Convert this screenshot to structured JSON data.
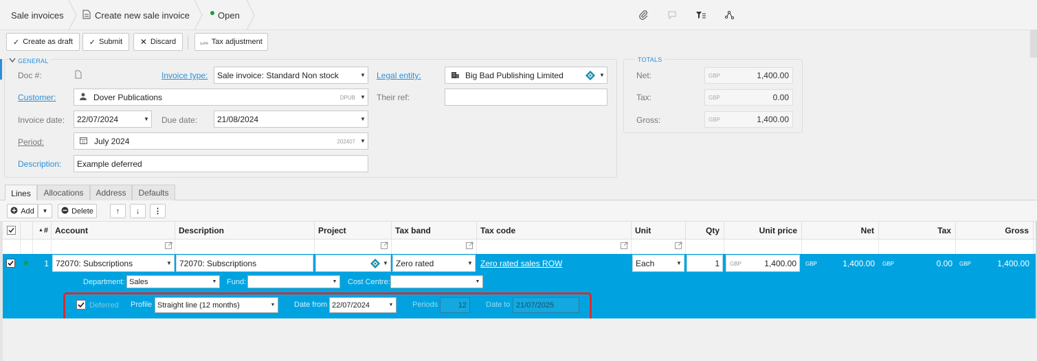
{
  "breadcrumb": {
    "items": [
      "Sale invoices",
      "Create new sale invoice",
      "Open"
    ]
  },
  "toolbar": {
    "create_draft": "Create as draft",
    "submit": "Submit",
    "discard": "Discard",
    "tax_adjustment": "Tax adjustment"
  },
  "general": {
    "section_title": "GENERAL",
    "doc_label": "Doc #:",
    "invoice_type_label": "Invoice type:",
    "invoice_type_value": "Sale invoice: Standard Non stock",
    "legal_entity_label": "Legal entity:",
    "legal_entity_value": "Big Bad Publishing Limited",
    "customer_label": "Customer:",
    "customer_value": "Dover Publications",
    "customer_code": "DPUB",
    "their_ref_label": "Their ref:",
    "their_ref_value": "",
    "invoice_date_label": "Invoice date:",
    "invoice_date_value": "22/07/2024",
    "due_date_label": "Due date:",
    "due_date_value": "21/08/2024",
    "period_label": "Period:",
    "period_value": "July 2024",
    "period_code": "202407",
    "description_label": "Description:",
    "description_value": "Example deferred"
  },
  "totals": {
    "section_title": "TOTALS",
    "net_label": "Net:",
    "net_value": "1,400.00",
    "tax_label": "Tax:",
    "tax_value": "0.00",
    "gross_label": "Gross:",
    "gross_value": "1,400.00",
    "currency": "GBP"
  },
  "tabs": [
    "Lines",
    "Allocations",
    "Address",
    "Defaults"
  ],
  "lines_toolbar": {
    "add": "Add",
    "delete": "Delete"
  },
  "grid": {
    "columns": {
      "num": "#",
      "account": "Account",
      "description": "Description",
      "project": "Project",
      "tax_band": "Tax band",
      "tax_code": "Tax code",
      "unit": "Unit",
      "qty": "Qty",
      "unit_price": "Unit price",
      "net": "Net",
      "tax": "Tax",
      "gross": "Gross"
    },
    "row": {
      "num": "1",
      "account": "72070: Subscriptions",
      "description": "72070: Subscriptions",
      "project": "",
      "tax_band": "Zero rated",
      "tax_code": "Zero rated sales ROW",
      "unit": "Each",
      "qty": "1",
      "currency": "GBP",
      "unit_price": "1,400.00",
      "net": "1,400.00",
      "tax": "0.00",
      "gross": "1,400.00",
      "department_label": "Department:",
      "department_value": "Sales",
      "fund_label": "Fund:",
      "fund_value": "",
      "cost_centre_label": "Cost Centre:",
      "cost_centre_value": "",
      "deferred_label": "Deferred",
      "profile_label": "Profile",
      "profile_value": "Straight line (12 months)",
      "date_from_label": "Date from",
      "date_from_value": "22/07/2024",
      "periods_label": "Periods",
      "periods_value": "12",
      "date_to_label": "Date to",
      "date_to_value": "21/07/2025"
    }
  },
  "colors": {
    "accent": "#2b8fd6",
    "selected_row": "#00a3e0",
    "highlight_box": "#d32f2f",
    "status_open": "#1a9c3a"
  }
}
